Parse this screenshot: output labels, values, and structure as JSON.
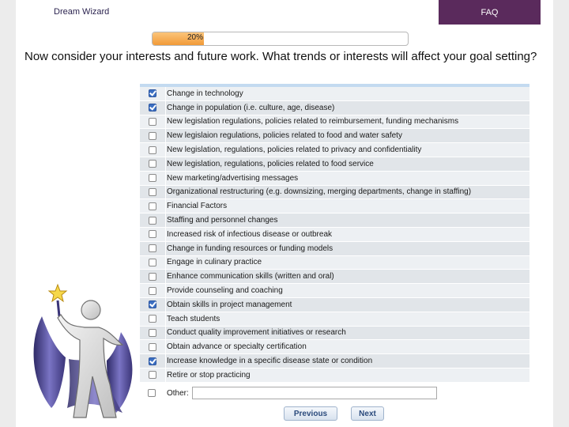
{
  "header": {
    "app_title": "Dream Wizard",
    "faq_label": "FAQ"
  },
  "progress": {
    "label": "20%",
    "percent": 20
  },
  "question": "Now consider your interests and future work. What trends or interests will affect your goal setting?",
  "options": [
    {
      "label": "Change in technology",
      "checked": true
    },
    {
      "label": "Change in population (i.e. culture, age, disease)",
      "checked": true
    },
    {
      "label": "New legislation regulations, policies related to reimbursement, funding mechanisms",
      "checked": false
    },
    {
      "label": "New legislaion regulations, policies related to food and water safety",
      "checked": false
    },
    {
      "label": "New legislation, regulations, policies related to privacy and confidentiality",
      "checked": false
    },
    {
      "label": "New legislation, regulations, policies related to food service",
      "checked": false
    },
    {
      "label": "New marketing/advertising messages",
      "checked": false
    },
    {
      "label": "Organizational restructuring (e.g. downsizing, merging departments, change in staffing)",
      "checked": false
    },
    {
      "label": "Financial Factors",
      "checked": false
    },
    {
      "label": "Staffing and personnel changes",
      "checked": false
    },
    {
      "label": "Increased risk of infectious disease or outbreak",
      "checked": false
    },
    {
      "label": "Change in funding resources or funding models",
      "checked": false
    },
    {
      "label": "Engage in culinary practice",
      "checked": false
    },
    {
      "label": "Enhance communication skills (written and oral)",
      "checked": false
    },
    {
      "label": "Provide counseling and coaching",
      "checked": false
    },
    {
      "label": "Obtain skills in project management",
      "checked": true
    },
    {
      "label": "Teach students",
      "checked": false
    },
    {
      "label": "Conduct quality improvement initiatives or research",
      "checked": false
    },
    {
      "label": "Obtain advance or specialty certification",
      "checked": false
    },
    {
      "label": "Increase knowledge in a specific disease state or condition",
      "checked": true
    },
    {
      "label": "Retire or stop practicing",
      "checked": false
    }
  ],
  "other": {
    "label": "Other:",
    "value": "",
    "checked": false
  },
  "buttons": {
    "previous": "Previous",
    "next": "Next"
  },
  "icons": {
    "logo": "wizard-figure-icon"
  },
  "colors": {
    "faq_tab": "#5a2a5c",
    "progress_fill": "#f19a38",
    "checkbox_checked": "#3c6fc2",
    "list_header": "#c3daf0"
  }
}
